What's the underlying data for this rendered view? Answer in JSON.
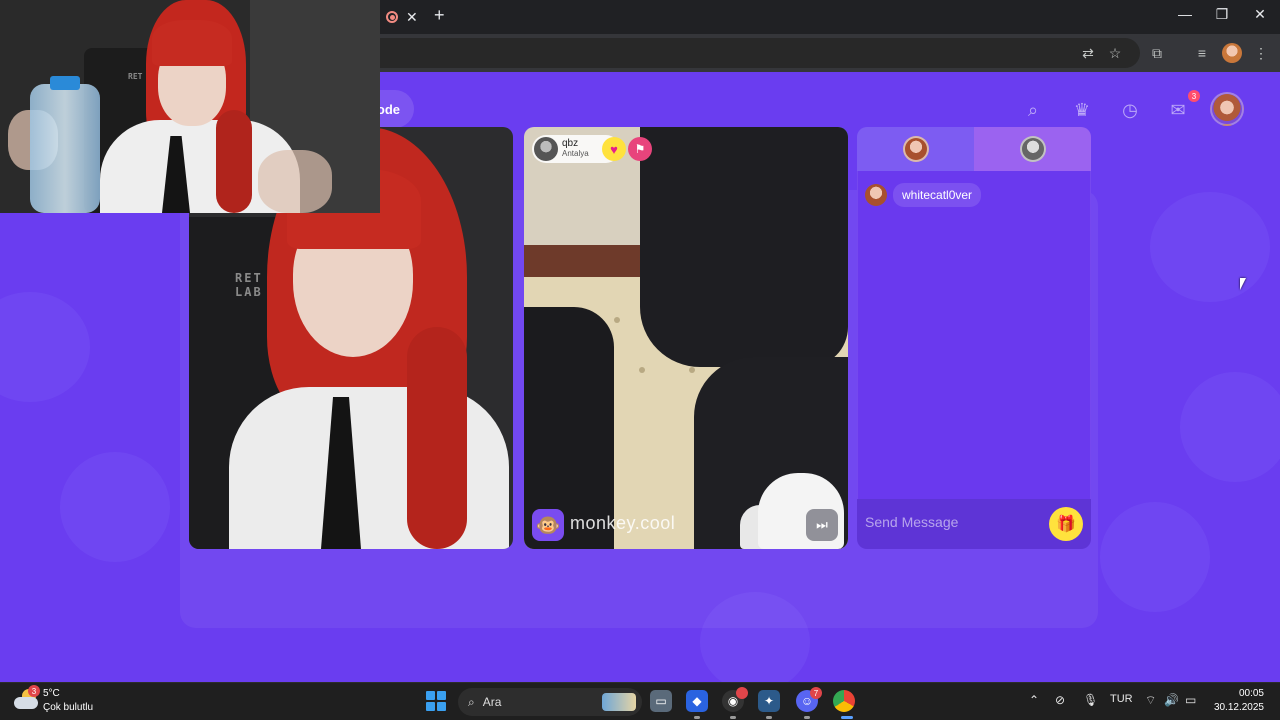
{
  "browser": {
    "tab_close": "✕",
    "new_tab": "+",
    "window_controls": {
      "minimize": "—",
      "restore": "❐",
      "close": "✕"
    }
  },
  "site": {
    "mode_label": "ode",
    "header": {
      "notification_count": "3"
    },
    "remote": {
      "username": "qbz",
      "location": "Antalya",
      "watermark": "monkey.cool"
    },
    "chat": {
      "messages": [
        {
          "author": "whitecatl0ver"
        }
      ],
      "input_placeholder": "Send Message"
    },
    "colors": {
      "background": "#6a3df0",
      "accent_yellow": "#ffe23d",
      "pink": "#e8447c"
    }
  },
  "webcam_overlay": {
    "chair_logo": "RET LAB"
  },
  "local_video": {
    "chair_logo": "RET\nLAB"
  },
  "taskbar": {
    "weather": {
      "temperature": "5°C",
      "description": "Çok bulutlu",
      "badge": "3"
    },
    "search_label": "Ara",
    "discord_badge": "7",
    "language": "TUR",
    "time": "00:05",
    "date": "30.12.2025"
  }
}
